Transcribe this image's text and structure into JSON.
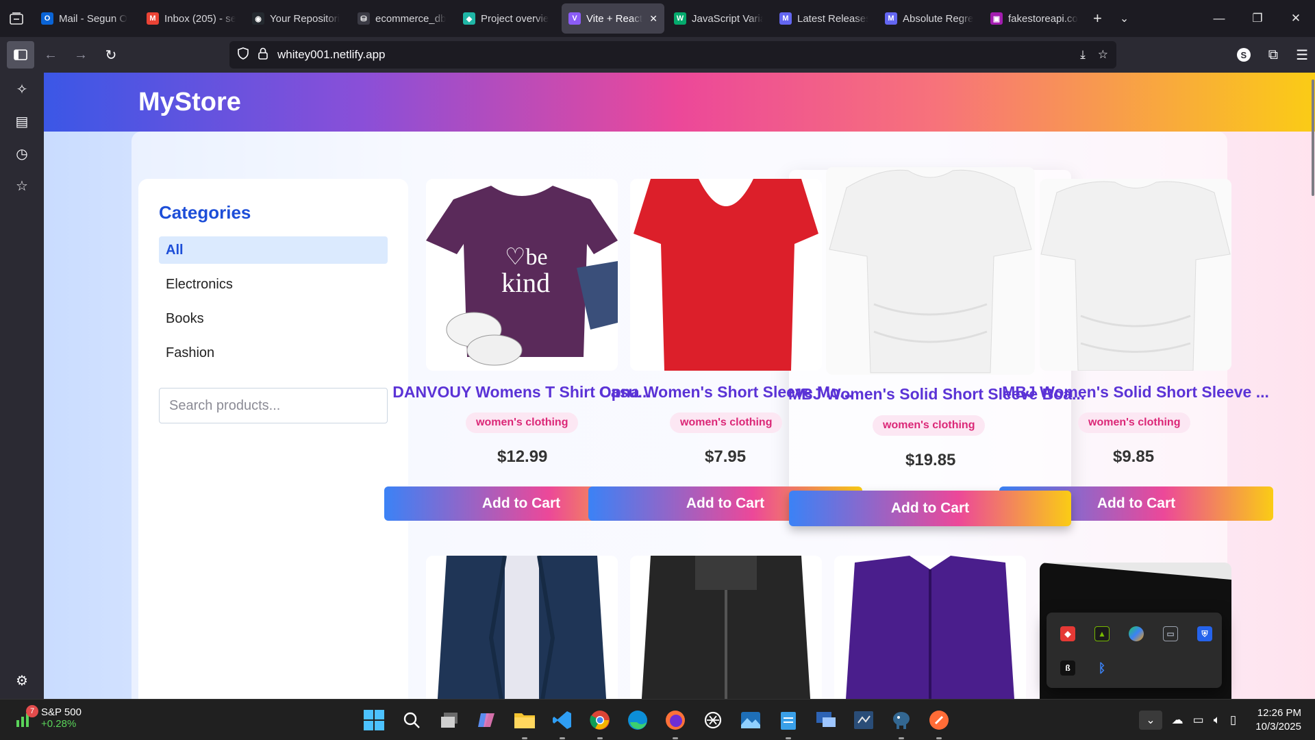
{
  "browser": {
    "tabs": [
      {
        "title": "Mail - Segun O",
        "icon": "outlook-icon",
        "color": "#0a64d6",
        "glyph": "O"
      },
      {
        "title": "Inbox (205) - se",
        "icon": "gmail-icon",
        "color": "#ea4335",
        "glyph": "M"
      },
      {
        "title": "Your Repositori",
        "icon": "github-icon",
        "color": "#24292f",
        "glyph": "◉"
      },
      {
        "title": "ecommerce_db",
        "icon": "db-icon",
        "color": "#3b3b45",
        "glyph": "⛁"
      },
      {
        "title": "Project overvie",
        "icon": "diamond-icon",
        "color": "#1fb6a6",
        "glyph": "◆"
      },
      {
        "title": "Vite + React",
        "icon": "vite-icon",
        "color": "#8b5cf6",
        "glyph": "V"
      },
      {
        "title": "JavaScript Varia",
        "icon": "w3-icon",
        "color": "#04aa6d",
        "glyph": "W"
      },
      {
        "title": "Latest Releases",
        "icon": "m-icon",
        "color": "#6366f1",
        "glyph": "M"
      },
      {
        "title": "Absolute Regre",
        "icon": "m-icon",
        "color": "#6366f1",
        "glyph": "M"
      },
      {
        "title": "fakestoreapi.co",
        "icon": "store-icon",
        "color": "#a21caf",
        "glyph": "▣"
      }
    ],
    "url": "whitey001.netlify.app"
  },
  "site": {
    "title": "MyStore",
    "categories_title": "Categories",
    "categories": [
      "All",
      "Electronics",
      "Books",
      "Fashion"
    ],
    "active_category": "All",
    "search_placeholder": "Search products..."
  },
  "products": [
    {
      "title": "DANVOUY Womens T Shirt Casu...",
      "category": "women's clothing",
      "price": "$12.99",
      "button": "Add to Cart"
    },
    {
      "title": "Opna Women's Short Sleeve Mo...",
      "category": "women's clothing",
      "price": "$7.95",
      "button": "Add to Cart"
    },
    {
      "title": "MBJ Women's Solid Short Sleeve Boa...",
      "category": "women's clothing",
      "price": "$19.85",
      "button": "Add to Cart"
    },
    {
      "title": "MBJ Women's Solid Short Sleeve ...",
      "category": "women's clothing",
      "price": "$9.85",
      "button": "Add to Cart"
    }
  ],
  "taskbar": {
    "stock_name": "S&P 500",
    "stock_delta": "+0.28%",
    "notification_count": "7",
    "time": "12:26 PM",
    "date": "10/3/2025"
  },
  "colors": {
    "accent": "#1d4ed8",
    "title_purple": "#5b33d6",
    "badge_pink": "#db2777"
  }
}
